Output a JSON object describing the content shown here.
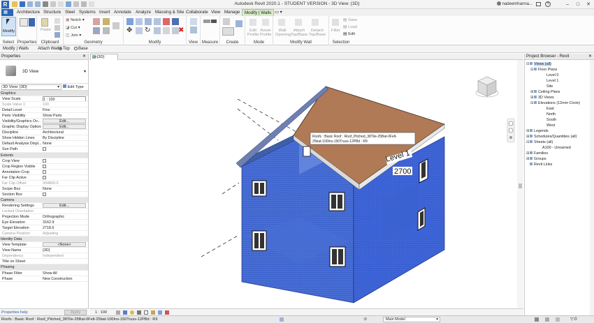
{
  "window": {
    "title": "Autodesk Revit 2020.1 - STUDENT VERSION - 3D View: {3D}",
    "user": "nadeemhanna...",
    "app_letter": "R"
  },
  "ribbon_tabs": [
    "Architecture",
    "Structure",
    "Steel",
    "Systems",
    "Insert",
    "Annotate",
    "Analyze",
    "Massing & Site",
    "Collaborate",
    "View",
    "Manage",
    "Modify | Walls"
  ],
  "ribbon": {
    "modify_label": "Modify",
    "notch": "Notch",
    "cut": "Cut",
    "join": "Join",
    "paste": "Paste",
    "edit_profile": "Edit Profile",
    "reset_profile": "Reset Profile",
    "wall_opening": "Wall Opening",
    "attach": "Attach Top/Base",
    "detach": "Detach Top/Base",
    "filter": "Filter",
    "save": "Save",
    "load": "Load",
    "edit": "Edit",
    "groups": [
      "Select",
      "Properties",
      "Clipboard",
      "Geometry",
      "Modify",
      "View",
      "Measure",
      "Create",
      "Mode",
      "Modify Wall",
      "Selection"
    ]
  },
  "options_bar": {
    "context": "Modify | Walls",
    "attach_wall": "Attach Wall:",
    "top": "Top",
    "base": "Base"
  },
  "properties": {
    "title": "Properties",
    "type_name": "3D View",
    "selector": "3D View: {3D}",
    "edit_type": "Edit Type",
    "rows": [
      {
        "cat": "Graphics"
      },
      {
        "k": "View Scale",
        "v": "1 : 100"
      },
      {
        "k": "Scale Value    1:",
        "v": "100",
        "dim": true
      },
      {
        "k": "Detail Level",
        "v": "Fine"
      },
      {
        "k": "Parts Visibility",
        "v": "Show Parts"
      },
      {
        "k": "Visibility/Graphics Ov...",
        "v": "Edit...",
        "btn": true
      },
      {
        "k": "Graphic Display Options",
        "v": "Edit...",
        "btn": true
      },
      {
        "k": "Discipline",
        "v": "Architectural"
      },
      {
        "k": "Show Hidden Lines",
        "v": "By Discipline"
      },
      {
        "k": "Default Analysis Displ...",
        "v": "None"
      },
      {
        "k": "Sun Path",
        "cb": true
      },
      {
        "cat": "Extents"
      },
      {
        "k": "Crop View",
        "cb": true
      },
      {
        "k": "Crop Region Visible",
        "cb": true
      },
      {
        "k": "Annotation Crop",
        "cb": true
      },
      {
        "k": "Far Clip Active",
        "cb": true
      },
      {
        "k": "Far Clip Offset",
        "v": "304800.0",
        "dim": true
      },
      {
        "k": "Scope Box",
        "v": "None"
      },
      {
        "k": "Section Box",
        "cb": true
      },
      {
        "cat": "Camera"
      },
      {
        "k": "Rendering Settings",
        "v": "Edit...",
        "btn": true
      },
      {
        "k": "Locked Orientation",
        "dim": true
      },
      {
        "k": "Projection Mode",
        "v": "Orthographic"
      },
      {
        "k": "Eye Elevation",
        "v": "3162.9"
      },
      {
        "k": "Target Elevation",
        "v": "2718.6"
      },
      {
        "k": "Camera Position",
        "v": "Adjusting",
        "dim": true
      },
      {
        "cat": "Identity Data"
      },
      {
        "k": "View Template",
        "v": "<None>",
        "btn": true
      },
      {
        "k": "View Name",
        "v": "{3D}"
      },
      {
        "k": "Dependency",
        "v": "Independent",
        "dim": true
      },
      {
        "k": "Title on Sheet",
        "v": ""
      },
      {
        "cat": "Phasing"
      },
      {
        "k": "Phase Filter",
        "v": "Show All"
      },
      {
        "k": "Phase",
        "v": "New Construction"
      }
    ],
    "help": "Properties help",
    "apply": "Apply"
  },
  "view_tab": "{3D}",
  "canvas": {
    "tooltip_line1": "Roofs : Basic Roof : Roof_Pitched_38Tile-25Bat-0Felt-",
    "tooltip_line2": "25bat-100Ins-150Truss-12PBd : R9",
    "level_name": "Level 1",
    "level_value": "2700"
  },
  "view_control": {
    "scale": "1 : 100"
  },
  "browser": {
    "title": "Project Browser - Revit",
    "nodes": [
      {
        "t": "Views (all)",
        "d": 0,
        "tw": "−",
        "sel": true
      },
      {
        "t": "Floor Plans",
        "d": 1,
        "tw": "−"
      },
      {
        "t": "Level 0",
        "d": 3
      },
      {
        "t": "Level 1",
        "d": 3
      },
      {
        "t": "Site",
        "d": 3
      },
      {
        "t": "Ceiling Plans",
        "d": 1,
        "tw": "+"
      },
      {
        "t": "3D Views",
        "d": 1,
        "tw": "+"
      },
      {
        "t": "Elevations (12mm Circle)",
        "d": 1,
        "tw": "−"
      },
      {
        "t": "East",
        "d": 3
      },
      {
        "t": "North",
        "d": 3
      },
      {
        "t": "South",
        "d": 3
      },
      {
        "t": "West",
        "d": 3
      },
      {
        "t": "Legends",
        "d": 0,
        "tw": "+"
      },
      {
        "t": "Schedules/Quantities (all)",
        "d": 0,
        "tw": "+"
      },
      {
        "t": "Sheets (all)",
        "d": 0,
        "tw": "−"
      },
      {
        "t": "A100 - Unnamed",
        "d": 2
      },
      {
        "t": "Families",
        "d": 0,
        "tw": "+"
      },
      {
        "t": "Groups",
        "d": 0,
        "tw": "+"
      },
      {
        "t": "Revit Links",
        "d": 0
      }
    ]
  },
  "status": {
    "text": "Roofs : Basic Roof : Roof_Pitched_38Tile-25Bat-0Felt-25bat-100Ins-150Truss-12PBd : R9",
    "zero": ":0",
    "model": "Main Model"
  },
  "colors": {
    "wall_blue": "#2f57d0",
    "roof_brown": "#b07a56",
    "file_tab": "#2a66b8",
    "context_tab": "#d8ecc8"
  }
}
